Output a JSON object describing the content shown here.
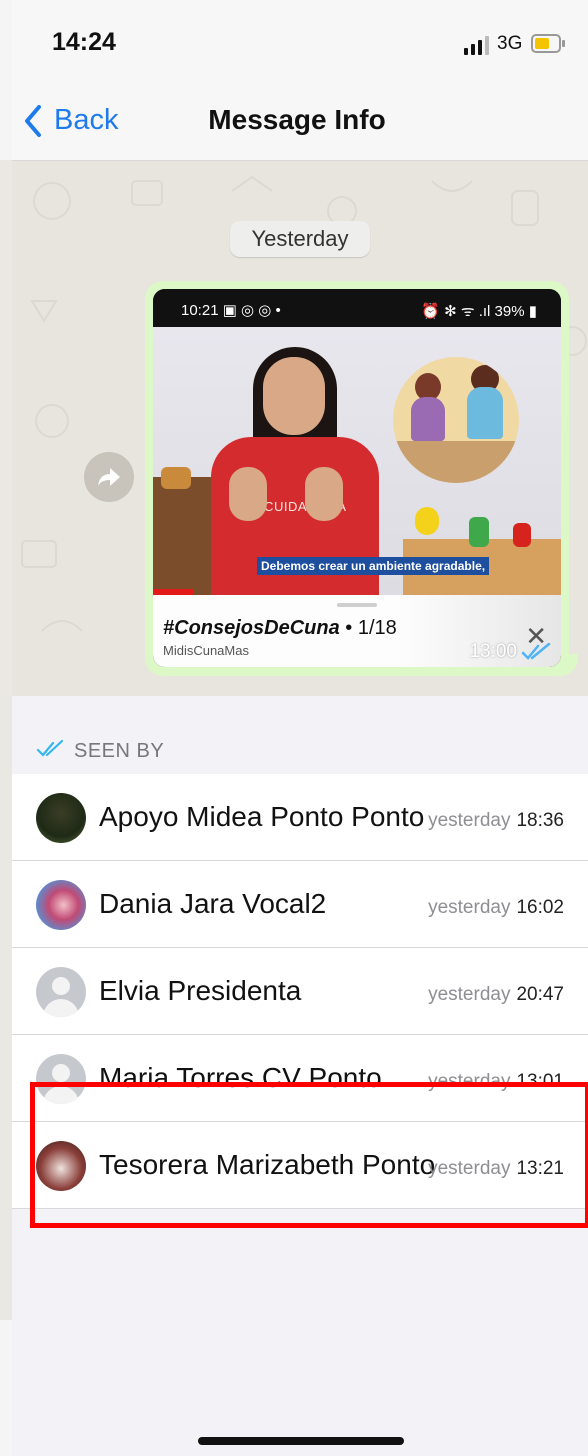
{
  "status_bar": {
    "time": "14:24",
    "network": "3G",
    "battery_color": "#f4c400"
  },
  "nav": {
    "back_label": "Back",
    "title": "Message Info"
  },
  "chat": {
    "date_label": "Yesterday",
    "video_status_left": "10:21 ▣ ◎ ◎ •",
    "video_status_right": "⏰ ✻ ᯤ .ıl 39% ▮",
    "apron_text": "DRE CUIDADORA",
    "video_caption": "Debemos crear un ambiente agradable,",
    "link_title_bold": "#ConsejosDeCuna",
    "link_title_rest": " • 1/18",
    "link_subtitle": "MidisCunaMas",
    "message_time": "13:00"
  },
  "seen_by": {
    "label": "SEEN BY",
    "tick_color": "#34b7f1",
    "rows": [
      {
        "name": "Apoyo Midea Ponto Ponto",
        "day": "yesterday",
        "time": "18:36"
      },
      {
        "name": "Dania Jara Vocal2",
        "day": "yesterday",
        "time": "16:02"
      },
      {
        "name": "Elvia Presidenta",
        "day": "yesterday",
        "time": "20:47"
      },
      {
        "name": "Maria Torres CV Ponto",
        "day": "yesterday",
        "time": "13:01"
      },
      {
        "name": "Tesorera Marizabeth Ponto",
        "day": "yesterday",
        "time": "13:21"
      }
    ]
  },
  "colors": {
    "accent": "#1f7aeb",
    "bubble": "#dcf8c6",
    "highlight": "#ff0000"
  }
}
